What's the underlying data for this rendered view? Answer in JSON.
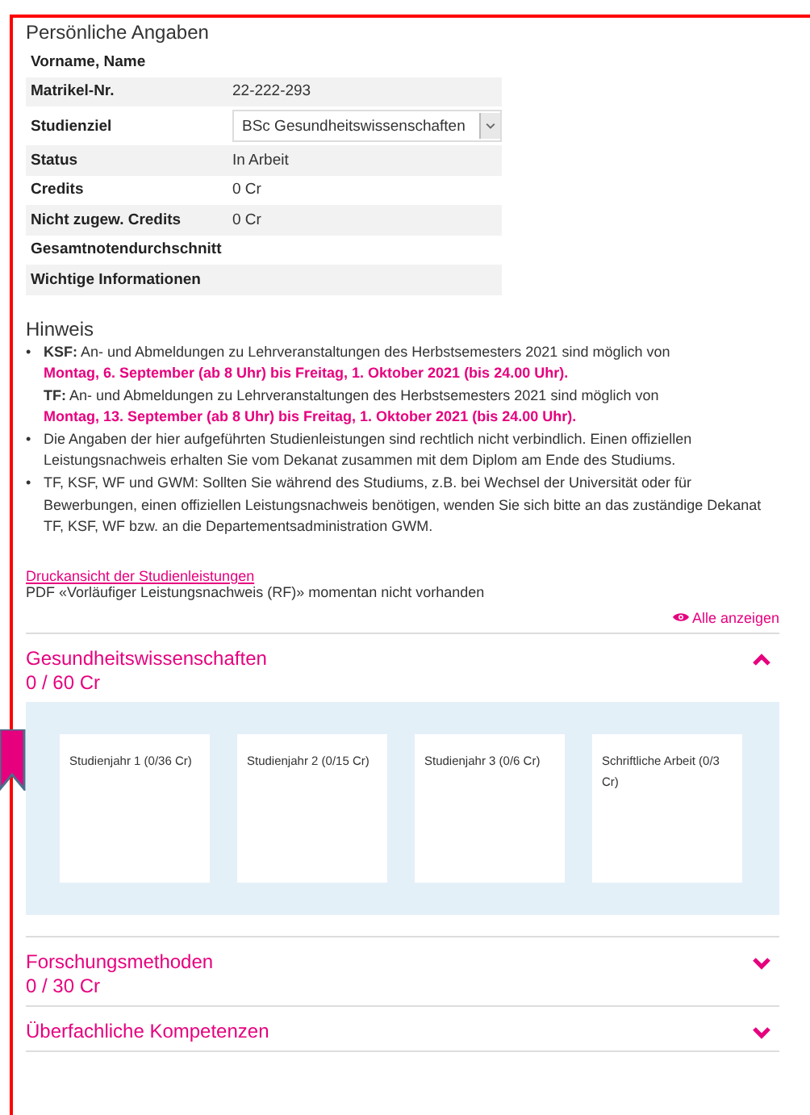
{
  "personal": {
    "title": "Persönliche Angaben",
    "rows": [
      {
        "label": "Vorname, Name",
        "kind": "text",
        "value": ""
      },
      {
        "label": "Matrikel-Nr.",
        "kind": "text",
        "value": "22-222-293"
      },
      {
        "label": "Studienziel",
        "kind": "select",
        "value": "BSc Gesundheitswissenschaften"
      },
      {
        "label": "Status",
        "kind": "text",
        "value": "In Arbeit"
      },
      {
        "label": "Credits",
        "kind": "text",
        "value": "0 Cr"
      },
      {
        "label": "Nicht zugew. Credits",
        "kind": "text",
        "value": "0 Cr"
      },
      {
        "label": "Gesamtnotendurchschnitt",
        "kind": "text",
        "value": ""
      },
      {
        "label": "Wichtige Informationen",
        "kind": "text",
        "value": ""
      }
    ]
  },
  "notice": {
    "title": "Hinweis",
    "items": [
      {
        "marker": "•",
        "parts": [
          {
            "text": "**KSF:** An- und Abmeldungen zu Lehrveranstaltungen des Herbstsemesters 2021 sind möglich von",
            "highlight": "Montag, 6. September (ab 8 Uhr) bis Freitag, 1. Oktober 2021 (bis 24.00 Uhr)."
          },
          {
            "text": "**TF:** An- und Abmeldungen zu Lehrveranstaltungen des Herbstsemesters 2021 sind möglich von",
            "highlight": "Montag, 13. September (ab 8 Uhr) bis Freitag, 1. Oktober 2021 (bis 24.00 Uhr)."
          }
        ]
      },
      {
        "marker": "•",
        "parts": [
          {
            "text": "Die Angaben der hier aufgeführten Studienleistungen sind rechtlich nicht verbindlich. Einen offiziellen Leistungsnachweis erhalten Sie vom Dekanat zusammen mit dem Diplom am Ende des Studiums."
          }
        ]
      },
      {
        "marker": "•",
        "parts": [
          {
            "text": "TF, KSF, WF und GWM: Sollten Sie während des Studiums, z.B. bei Wechsel der Universität oder für Bewerbungen, einen offiziellen Leistungsnachweis benötigen, wenden Sie sich bitte an das zuständige Dekanat TF, KSF, WF bzw. an die Departementsadministration GWM."
          }
        ]
      }
    ]
  },
  "print_link": "Druckansicht der Studienleistungen",
  "pdf_note": "PDF «Vorläufiger Leistungsnachweis (RF)» momentan nicht vorhanden",
  "show_all": "Alle anzeigen",
  "sections": [
    {
      "title": "Gesundheitswissenschaften",
      "credits": "0 / 60 Cr",
      "expanded": true,
      "cards": [
        "Studienjahr 1 (0/36 Cr)",
        "Studienjahr 2 (0/15 Cr)",
        "Studienjahr 3 (0/6 Cr)",
        "Schriftliche Arbeit (0/3 Cr)"
      ]
    },
    {
      "title": "Forschungsmethoden",
      "credits": "0 / 30 Cr",
      "expanded": false
    },
    {
      "title": "Überfachliche Kompetenzen",
      "expanded": false
    }
  ]
}
